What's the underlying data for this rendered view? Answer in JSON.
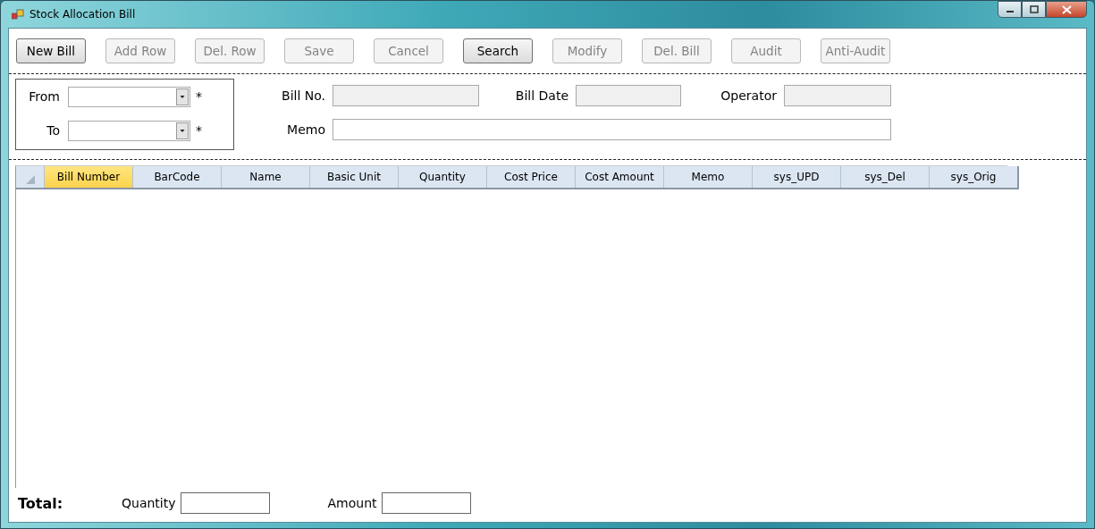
{
  "window": {
    "title": "Stock Allocation Bill"
  },
  "toolbar": [
    {
      "label": "New Bill",
      "disabled": false
    },
    {
      "label": "Add Row",
      "disabled": true
    },
    {
      "label": "Del. Row",
      "disabled": true
    },
    {
      "label": "Save",
      "disabled": true
    },
    {
      "label": "Cancel",
      "disabled": true
    },
    {
      "label": "Search",
      "disabled": false
    },
    {
      "label": "Modify",
      "disabled": true
    },
    {
      "label": "Del. Bill",
      "disabled": true
    },
    {
      "label": "Audit",
      "disabled": true
    },
    {
      "label": "Anti-Audit",
      "disabled": true
    }
  ],
  "warehouse": [
    {
      "label": "From",
      "required": "*"
    },
    {
      "label": "To",
      "required": "*"
    }
  ],
  "header_fields": [
    {
      "label": "Bill No.",
      "disabled": true
    },
    {
      "label": "Bill Date",
      "disabled": true
    },
    {
      "label": "Operator",
      "disabled": true
    }
  ],
  "memo": {
    "label": "Memo"
  },
  "table": {
    "columns": [
      {
        "label": "Bill Number",
        "selected": true
      },
      {
        "label": "BarCode",
        "selected": false
      },
      {
        "label": "Name",
        "selected": false
      },
      {
        "label": "Basic Unit",
        "selected": false
      },
      {
        "label": "Quantity",
        "selected": false
      },
      {
        "label": "Cost Price",
        "selected": false
      },
      {
        "label": "Cost Amount",
        "selected": false
      },
      {
        "label": "Memo",
        "selected": false
      },
      {
        "label": "sys_UPD",
        "selected": false
      },
      {
        "label": "sys_Del",
        "selected": false
      },
      {
        "label": "sys_Orig",
        "selected": false
      }
    ]
  },
  "footer": {
    "title": "Total:",
    "fields": [
      {
        "label": "Quantity"
      },
      {
        "label": "Amount"
      }
    ]
  }
}
